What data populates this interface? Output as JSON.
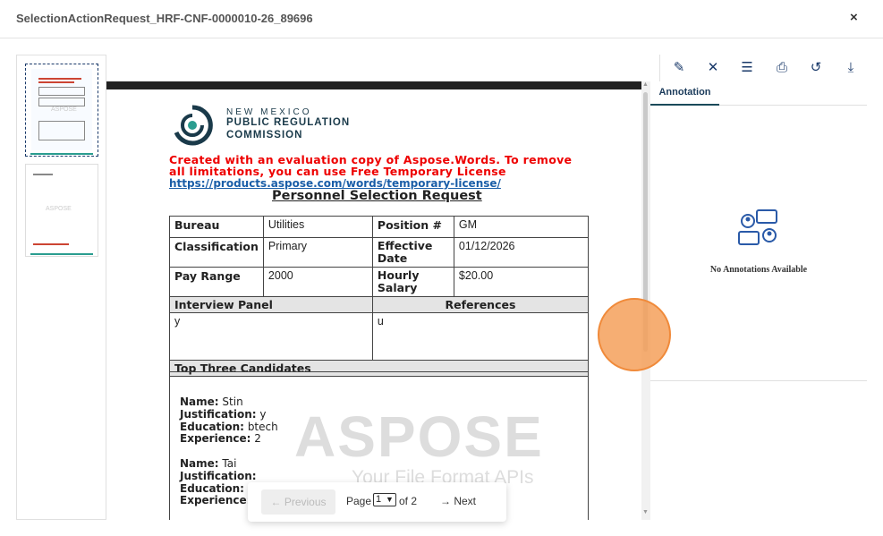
{
  "window": {
    "title": "SelectionActionRequest_HRF-CNF-0000010-26_89696",
    "close_label": "×"
  },
  "thumbnails": [
    {
      "label": "Page 1 thumbnail",
      "watermark": "ASPOSE"
    },
    {
      "label": "Page 2 thumbnail",
      "watermark": "ASPOSE"
    }
  ],
  "document": {
    "org_line1": "NEW MEXICO",
    "org_line2": "PUBLIC REGULATION",
    "org_line3": "COMMISSION",
    "eval_notice": "Created with an evaluation copy of Aspose.Words. To remove all limitations, you can use Free Temporary License",
    "eval_link": "https://products.aspose.com/words/temporary-license/",
    "title": "Personnel Selection Request",
    "fields": {
      "bureau_label": "Bureau",
      "bureau_value": "Utilities",
      "position_label": "Position #",
      "position_value": "GM",
      "classification_label": "Classification",
      "classification_value": "Primary",
      "effective_label": "Effective Date",
      "effective_value": "01/12/2026",
      "pay_label": "Pay Range",
      "pay_value": "2000",
      "hourly_label": "Hourly Salary",
      "hourly_value": "$20.00",
      "interview_label": "Interview Panel",
      "interview_value": "y",
      "references_label": "References",
      "references_value": "u",
      "top_label": "Top Three Candidates"
    },
    "candidates": [
      {
        "name_label": "Name:",
        "name": "Stin",
        "just_label": "Justification:",
        "justification": "y",
        "edu_label": "Education:",
        "education": "btech",
        "exp_label": "Experience:",
        "experience": "2"
      },
      {
        "name_label": "Name:",
        "name": "Tai",
        "just_label": "Justification:",
        "justification": "",
        "edu_label": "Education:",
        "education": "l",
        "exp_label": "Experience:",
        "experience": ""
      }
    ],
    "watermark": "ASPOSE",
    "watermark_sub": "Your File Format APIs"
  },
  "pager": {
    "prev": "← Previous",
    "page_label": "Page",
    "page_value": "1",
    "of_label": "of 2",
    "next": "→ Next"
  },
  "sidebar": {
    "toolbar": [
      {
        "name": "edit-document-icon",
        "glyph": "✎"
      },
      {
        "name": "tools-icon",
        "glyph": "✕"
      },
      {
        "name": "list-icon",
        "glyph": "☰"
      },
      {
        "name": "print-icon",
        "glyph": "⎙"
      },
      {
        "name": "history-icon",
        "glyph": "↺"
      },
      {
        "name": "download-icon",
        "glyph": "⤓"
      }
    ],
    "tab_label": "Annotation",
    "empty_message": "No Annotations Available"
  },
  "colors": {
    "accent": "#1a3a6a",
    "eval_red": "#e00000",
    "touch_marker": "#f5a05a"
  }
}
